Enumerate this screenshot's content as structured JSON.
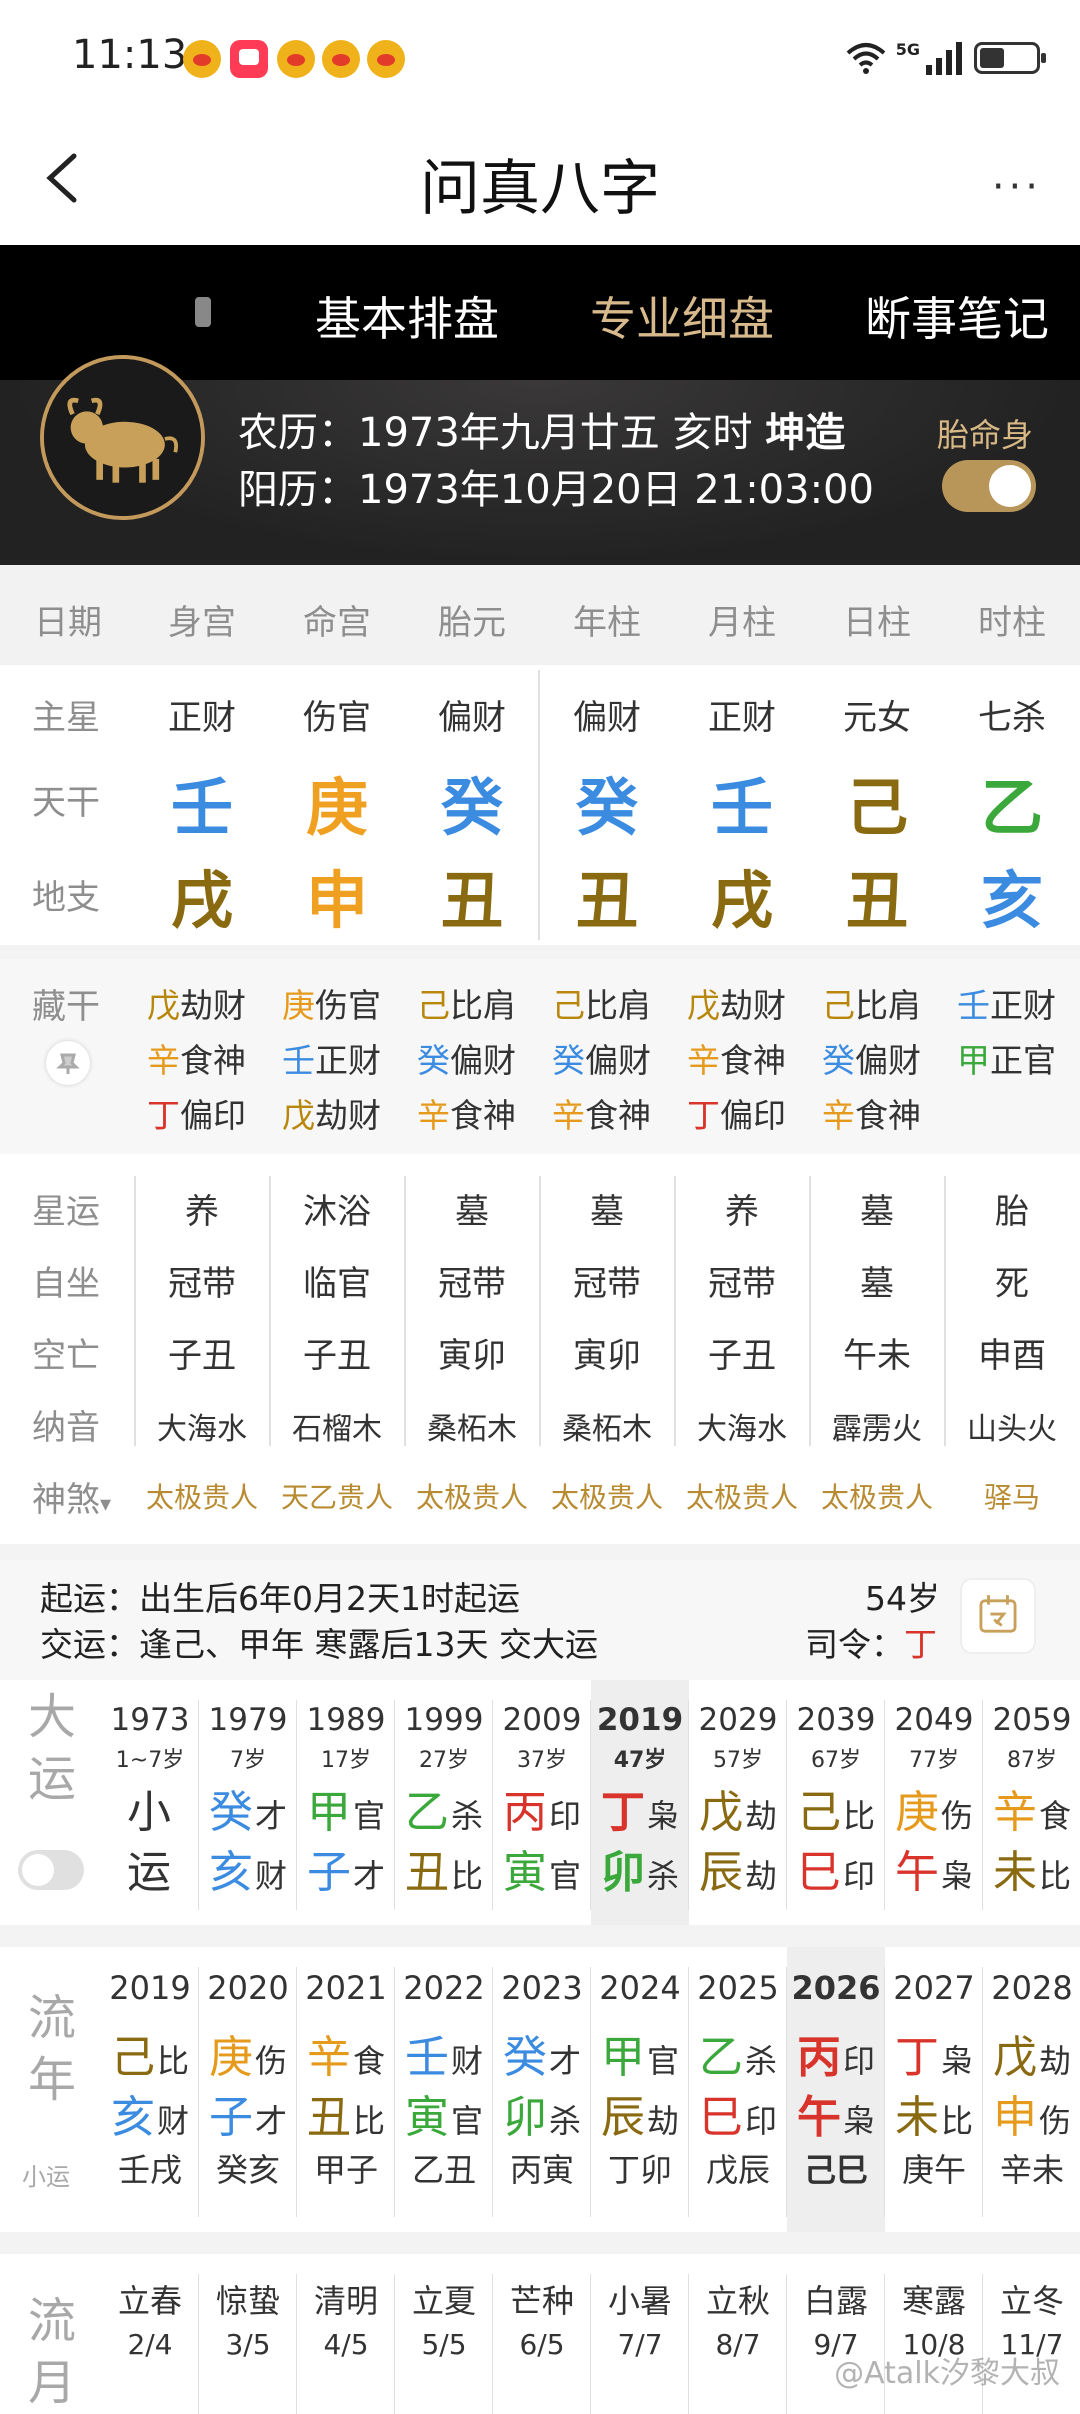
{
  "status_bar": {
    "time": "11:13",
    "network": "5G"
  },
  "app_bar": {
    "title": "问真八字",
    "more": "···"
  },
  "tabs": {
    "items": [
      "基本排盘",
      "专业细盘",
      "断事笔记"
    ],
    "active": "专业细盘"
  },
  "profile": {
    "lunar_label": "农历：",
    "lunar": "1973年九月廿五 亥时",
    "gender": "坤造",
    "solar_label": "阳历：",
    "solar": "1973年10月20日 21:03:00",
    "taiming_label": "胎命身",
    "taiming_enabled": true
  },
  "header_row": [
    "日期",
    "身宫",
    "命宫",
    "胎元",
    "年柱",
    "月柱",
    "日柱",
    "时柱"
  ],
  "main_star": {
    "label": "主星",
    "values": [
      "正财",
      "伤官",
      "偏财",
      "偏财",
      "正财",
      "元女",
      "七杀"
    ]
  },
  "tian_gan": {
    "label": "天干",
    "values": [
      "壬",
      "庚",
      "癸",
      "癸",
      "壬",
      "己",
      "乙"
    ],
    "colors": [
      "#3b8be0",
      "#f0a020",
      "#3b8be0",
      "#3b8be0",
      "#3b8be0",
      "#8a6a10",
      "#3aa83a"
    ]
  },
  "di_zhi": {
    "label": "地支",
    "values": [
      "戌",
      "申",
      "丑",
      "丑",
      "戌",
      "丑",
      "亥"
    ],
    "colors": [
      "#8a6a10",
      "#f0a020",
      "#8a6a10",
      "#8a6a10",
      "#8a6a10",
      "#8a6a10",
      "#3b8be0"
    ]
  },
  "cang_gan": {
    "label": "藏干",
    "columns": [
      [
        {
          "g": "戊",
          "s": "劫财",
          "c": "#b8860b"
        },
        {
          "g": "辛",
          "s": "食神",
          "c": "#e69a1c"
        },
        {
          "g": "丁",
          "s": "偏印",
          "c": "#d9342b"
        }
      ],
      [
        {
          "g": "庚",
          "s": "伤官",
          "c": "#e69a1c"
        },
        {
          "g": "壬",
          "s": "正财",
          "c": "#3b8be0"
        },
        {
          "g": "戊",
          "s": "劫财",
          "c": "#b8860b"
        }
      ],
      [
        {
          "g": "己",
          "s": "比肩",
          "c": "#b8860b"
        },
        {
          "g": "癸",
          "s": "偏财",
          "c": "#3b8be0"
        },
        {
          "g": "辛",
          "s": "食神",
          "c": "#e69a1c"
        }
      ],
      [
        {
          "g": "己",
          "s": "比肩",
          "c": "#b8860b"
        },
        {
          "g": "癸",
          "s": "偏财",
          "c": "#3b8be0"
        },
        {
          "g": "辛",
          "s": "食神",
          "c": "#e69a1c"
        }
      ],
      [
        {
          "g": "戊",
          "s": "劫财",
          "c": "#b8860b"
        },
        {
          "g": "辛",
          "s": "食神",
          "c": "#e69a1c"
        },
        {
          "g": "丁",
          "s": "偏印",
          "c": "#d9342b"
        }
      ],
      [
        {
          "g": "己",
          "s": "比肩",
          "c": "#b8860b"
        },
        {
          "g": "癸",
          "s": "偏财",
          "c": "#3b8be0"
        },
        {
          "g": "辛",
          "s": "食神",
          "c": "#e69a1c"
        }
      ],
      [
        {
          "g": "壬",
          "s": "正财",
          "c": "#3b8be0"
        },
        {
          "g": "甲",
          "s": "正官",
          "c": "#3aa83a"
        }
      ]
    ]
  },
  "xing_yun": {
    "label": "星运",
    "values": [
      "养",
      "沐浴",
      "墓",
      "墓",
      "养",
      "墓",
      "胎"
    ]
  },
  "zi_zuo": {
    "label": "自坐",
    "values": [
      "冠带",
      "临官",
      "冠带",
      "冠带",
      "冠带",
      "墓",
      "死"
    ]
  },
  "kong_wang": {
    "label": "空亡",
    "values": [
      "子丑",
      "子丑",
      "寅卯",
      "寅卯",
      "子丑",
      "午未",
      "申酉"
    ]
  },
  "na_yin": {
    "label": "纳音",
    "values": [
      "大海水",
      "石榴木",
      "桑柘木",
      "桑柘木",
      "大海水",
      "霹雳火",
      "山头火"
    ]
  },
  "shen_sha": {
    "label": "神煞",
    "values": [
      "太极贵人",
      "天乙贵人",
      "太极贵人",
      "太极贵人",
      "太极贵人",
      "太极贵人",
      "驿马"
    ]
  },
  "qi_yun": {
    "qi_label": "起运：",
    "qi_text": "出生后6年0月2天1时起运",
    "jiao_label": "交运：",
    "jiao_text": "逢己、甲年 寒露后13天 交大运",
    "age": "54岁",
    "siling_label": "司令：",
    "siling_value": "丁"
  },
  "da_yun": {
    "side": [
      "大",
      "运"
    ],
    "columns": [
      {
        "year": "1973",
        "age": "1~7岁",
        "g": "小",
        "gs": "",
        "z": "运",
        "zs": "",
        "gc": "#333",
        "zc": "#333"
      },
      {
        "year": "1979",
        "age": "7岁",
        "g": "癸",
        "gs": "才",
        "z": "亥",
        "zs": "财",
        "gc": "#3b8be0",
        "zc": "#3b8be0"
      },
      {
        "year": "1989",
        "age": "17岁",
        "g": "甲",
        "gs": "官",
        "z": "子",
        "zs": "才",
        "gc": "#3aa83a",
        "zc": "#3b8be0"
      },
      {
        "year": "1999",
        "age": "27岁",
        "g": "乙",
        "gs": "杀",
        "z": "丑",
        "zs": "比",
        "gc": "#3aa83a",
        "zc": "#8a6a10"
      },
      {
        "year": "2009",
        "age": "37岁",
        "g": "丙",
        "gs": "印",
        "z": "寅",
        "zs": "官",
        "gc": "#d9342b",
        "zc": "#3aa83a"
      },
      {
        "year": "2019",
        "age": "47岁",
        "g": "丁",
        "gs": "枭",
        "z": "卯",
        "zs": "杀",
        "gc": "#d9342b",
        "zc": "#3aa83a",
        "current": true
      },
      {
        "year": "2029",
        "age": "57岁",
        "g": "戊",
        "gs": "劫",
        "z": "辰",
        "zs": "劫",
        "gc": "#8a6a10",
        "zc": "#8a6a10"
      },
      {
        "year": "2039",
        "age": "67岁",
        "g": "己",
        "gs": "比",
        "z": "巳",
        "zs": "印",
        "gc": "#8a6a10",
        "zc": "#d9342b"
      },
      {
        "year": "2049",
        "age": "77岁",
        "g": "庚",
        "gs": "伤",
        "z": "午",
        "zs": "枭",
        "gc": "#e69a1c",
        "zc": "#d9342b"
      },
      {
        "year": "2059",
        "age": "87岁",
        "g": "辛",
        "gs": "食",
        "z": "未",
        "zs": "比",
        "gc": "#e69a1c",
        "zc": "#8a6a10"
      }
    ]
  },
  "liu_nian": {
    "side": [
      "流",
      "年"
    ],
    "sub": "小运",
    "columns": [
      {
        "year": "2019",
        "g": "己",
        "gs": "比",
        "z": "亥",
        "zs": "财",
        "x": "壬戌",
        "gc": "#8a6a10",
        "zc": "#3b8be0"
      },
      {
        "year": "2020",
        "g": "庚",
        "gs": "伤",
        "z": "子",
        "zs": "才",
        "x": "癸亥",
        "gc": "#e69a1c",
        "zc": "#3b8be0"
      },
      {
        "year": "2021",
        "g": "辛",
        "gs": "食",
        "z": "丑",
        "zs": "比",
        "x": "甲子",
        "gc": "#e69a1c",
        "zc": "#8a6a10"
      },
      {
        "year": "2022",
        "g": "壬",
        "gs": "财",
        "z": "寅",
        "zs": "官",
        "x": "乙丑",
        "gc": "#3b8be0",
        "zc": "#3aa83a"
      },
      {
        "year": "2023",
        "g": "癸",
        "gs": "才",
        "z": "卯",
        "zs": "杀",
        "x": "丙寅",
        "gc": "#3b8be0",
        "zc": "#3aa83a"
      },
      {
        "year": "2024",
        "g": "甲",
        "gs": "官",
        "z": "辰",
        "zs": "劫",
        "x": "丁卯",
        "gc": "#3aa83a",
        "zc": "#8a6a10"
      },
      {
        "year": "2025",
        "g": "乙",
        "gs": "杀",
        "z": "巳",
        "zs": "印",
        "x": "戊辰",
        "gc": "#3aa83a",
        "zc": "#d9342b"
      },
      {
        "year": "2026",
        "g": "丙",
        "gs": "印",
        "z": "午",
        "zs": "枭",
        "x": "己巳",
        "gc": "#d9342b",
        "zc": "#d9342b",
        "current": true
      },
      {
        "year": "2027",
        "g": "丁",
        "gs": "枭",
        "z": "未",
        "zs": "比",
        "x": "庚午",
        "gc": "#d9342b",
        "zc": "#8a6a10"
      },
      {
        "year": "2028",
        "g": "戊",
        "gs": "劫",
        "z": "申",
        "zs": "伤",
        "x": "辛未",
        "gc": "#8a6a10",
        "zc": "#e69a1c"
      }
    ]
  },
  "liu_yue": {
    "side": [
      "流",
      "月"
    ],
    "columns": [
      {
        "jie": "立春",
        "date": "2/4"
      },
      {
        "jie": "惊蛰",
        "date": "3/5"
      },
      {
        "jie": "清明",
        "date": "4/5"
      },
      {
        "jie": "立夏",
        "date": "5/5"
      },
      {
        "jie": "芒种",
        "date": "6/5"
      },
      {
        "jie": "小暑",
        "date": "7/7"
      },
      {
        "jie": "立秋",
        "date": "8/7"
      },
      {
        "jie": "白露",
        "date": "9/7"
      },
      {
        "jie": "寒露",
        "date": "10/8"
      },
      {
        "jie": "立冬",
        "date": "11/7"
      }
    ]
  },
  "watermark": "@Atalk汐黎大叔",
  "colors": {
    "accent_gold": "#d7b98c",
    "dark_bg": "#000000",
    "highlight": "#eeeeee"
  }
}
